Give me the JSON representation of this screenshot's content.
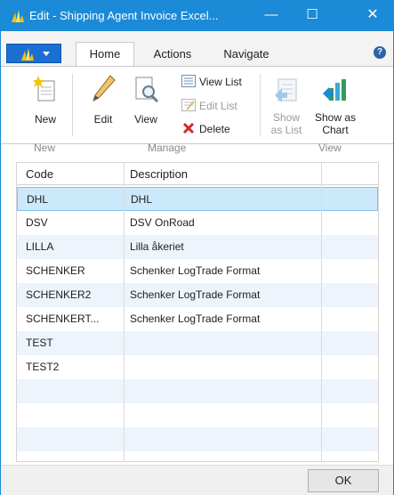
{
  "window": {
    "title": "Edit - Shipping Agent Invoice Excel...",
    "minimize_glyph": "—",
    "maximize_glyph": "☐",
    "close_glyph": "✕",
    "accent_color": "#1b8ad7"
  },
  "ribbon_tabs": [
    {
      "label": "Home",
      "active": true
    },
    {
      "label": "Actions",
      "active": false
    },
    {
      "label": "Navigate",
      "active": false
    }
  ],
  "help_glyph": "?",
  "ribbon": {
    "groups": [
      {
        "label": "New",
        "buttons": [
          {
            "label": "New",
            "icon": "new-document-icon",
            "enabled": true
          }
        ]
      },
      {
        "label": "Manage",
        "buttons": [
          {
            "label": "Edit",
            "icon": "pencil-icon",
            "enabled": true
          },
          {
            "label": "View",
            "icon": "view-document-icon",
            "enabled": true
          },
          {
            "label": "View List",
            "icon": "view-list-icon",
            "enabled": true
          },
          {
            "label": "Edit List",
            "icon": "edit-list-icon",
            "enabled": false
          },
          {
            "label": "Delete",
            "icon": "delete-x-icon",
            "enabled": true
          }
        ]
      },
      {
        "label": "View",
        "buttons": [
          {
            "label": "Show as List",
            "line1": "Show",
            "line2": "as List",
            "icon": "show-as-list-icon",
            "enabled": false
          },
          {
            "label": "Show as Chart",
            "line1": "Show as",
            "line2": "Chart",
            "icon": "show-as-chart-icon",
            "enabled": true
          }
        ]
      }
    ]
  },
  "grid": {
    "columns": [
      "Code",
      "Description"
    ],
    "rows": [
      {
        "code": "DHL",
        "description": "DHL",
        "selected": true
      },
      {
        "code": "DSV",
        "description": "DSV OnRoad"
      },
      {
        "code": "LILLA",
        "description": "Lilla åkeriet"
      },
      {
        "code": "SCHENKER",
        "description": "Schenker LogTrade Format"
      },
      {
        "code": "SCHENKER2",
        "description": "Schenker LogTrade Format"
      },
      {
        "code": "SCHENKERT...",
        "description": "Schenker LogTrade Format"
      },
      {
        "code": "TEST",
        "description": ""
      },
      {
        "code": "TEST2",
        "description": ""
      }
    ]
  },
  "footer": {
    "ok_label": "OK"
  }
}
